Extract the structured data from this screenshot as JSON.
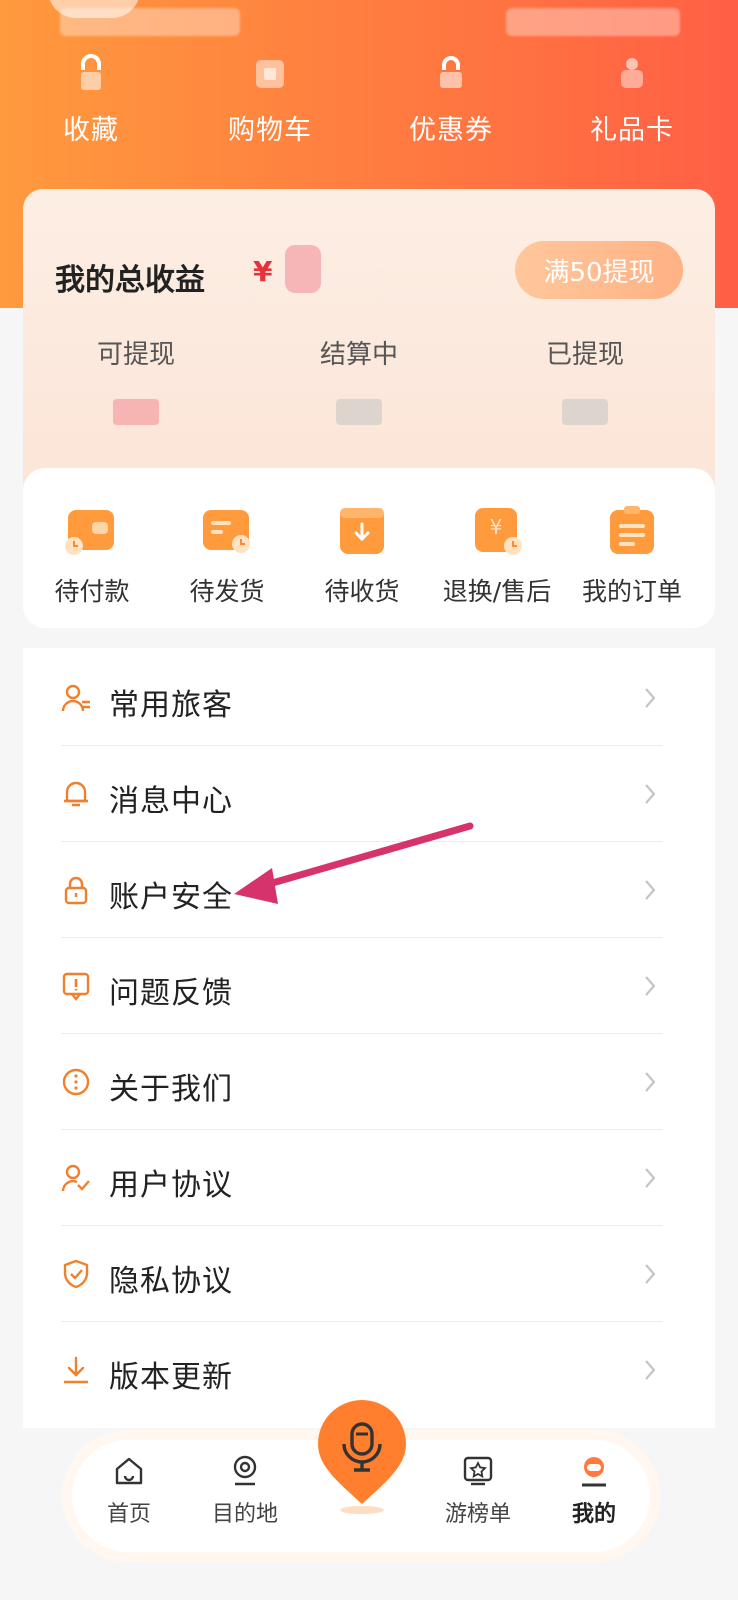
{
  "quick_actions": [
    {
      "label": "收藏",
      "icon": "favorite-icon"
    },
    {
      "label": "购物车",
      "icon": "cart-icon"
    },
    {
      "label": "优惠券",
      "icon": "coupon-icon"
    },
    {
      "label": "礼品卡",
      "icon": "gift-card-icon"
    }
  ],
  "earnings": {
    "title": "我的总收益",
    "currency": "¥",
    "withdraw_button": "满50提现",
    "stats": [
      {
        "label": "可提现"
      },
      {
        "label": "结算中"
      },
      {
        "label": "已提现"
      }
    ]
  },
  "orders": [
    {
      "label": "待付款",
      "icon": "wallet-clock-icon"
    },
    {
      "label": "待发货",
      "icon": "box-clock-icon"
    },
    {
      "label": "待收货",
      "icon": "box-download-icon"
    },
    {
      "label": "退换/售后",
      "icon": "yen-refund-icon"
    },
    {
      "label": "我的订单",
      "icon": "order-list-icon"
    }
  ],
  "menu": [
    {
      "label": "常用旅客",
      "icon": "traveler-icon"
    },
    {
      "label": "消息中心",
      "icon": "bell-icon"
    },
    {
      "label": "账户安全",
      "icon": "lock-icon"
    },
    {
      "label": "问题反馈",
      "icon": "feedback-icon"
    },
    {
      "label": "关于我们",
      "icon": "info-dots-icon"
    },
    {
      "label": "用户协议",
      "icon": "user-agreement-icon"
    },
    {
      "label": "隐私协议",
      "icon": "shield-check-icon"
    },
    {
      "label": "版本更新",
      "icon": "download-icon"
    }
  ],
  "tabbar": [
    {
      "label": "首页",
      "icon": "home-icon"
    },
    {
      "label": "目的地",
      "icon": "location-icon"
    },
    {
      "label": "游榜单",
      "icon": "ranking-icon"
    },
    {
      "label": "我的",
      "icon": "profile-icon",
      "active": true
    }
  ],
  "colors": {
    "accent": "#ff7a3c",
    "header_start": "#ff9a3e",
    "header_end": "#ff5f45",
    "annotation_arrow": "#d6336c"
  }
}
